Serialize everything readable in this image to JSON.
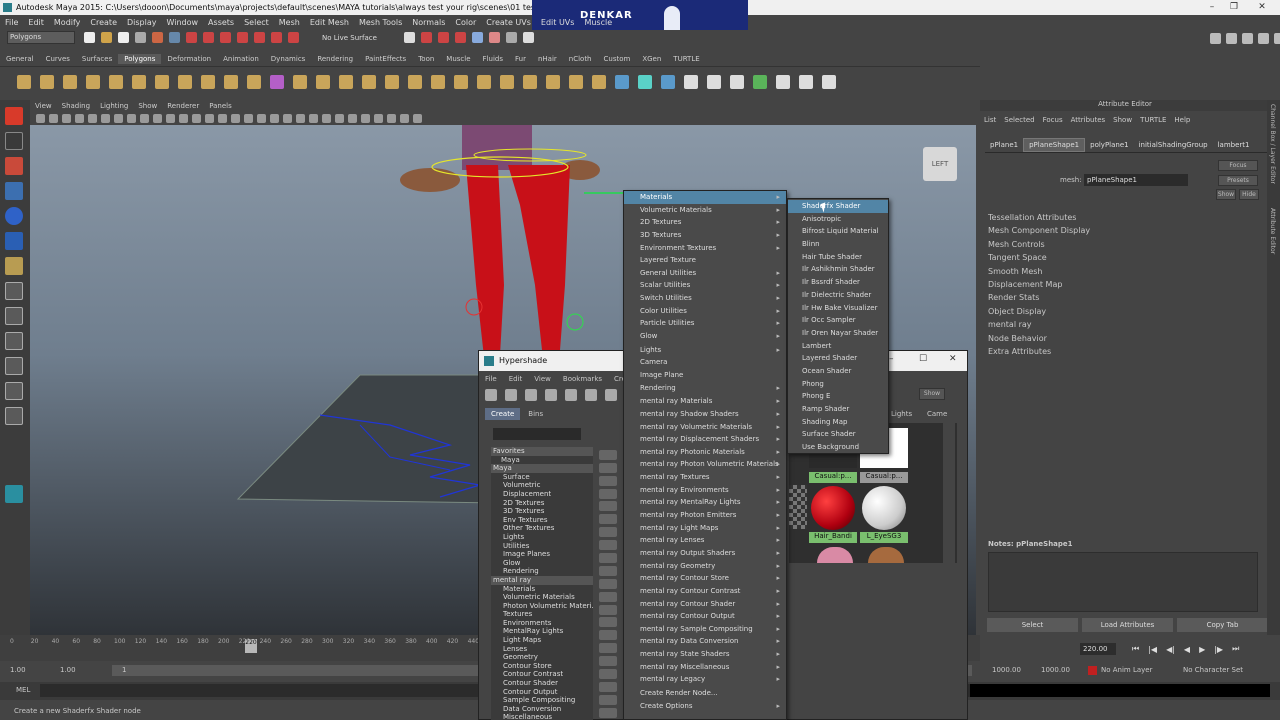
{
  "window": {
    "title": "Autodesk Maya 2015: C:\\Users\\dooon\\Documents\\maya\\projects\\default\\scenes\\MAYA tutorials\\always test your rig\\scenes\\01 test rig.mb*  ---"
  },
  "logo": {
    "text": "DENKAR"
  },
  "menubar": [
    "File",
    "Edit",
    "Modify",
    "Create",
    "Display",
    "Window",
    "Assets",
    "Select",
    "Mesh",
    "Edit Mesh",
    "Mesh Tools",
    "Normals",
    "Color",
    "Create UVs",
    "Edit UVs",
    "Muscle"
  ],
  "statusline": {
    "menuset": "Polygons",
    "live_surface": "No Live Surface"
  },
  "shelf": {
    "tabs": [
      "General",
      "Curves",
      "Surfaces",
      "Polygons",
      "Deformation",
      "Animation",
      "Dynamics",
      "Rendering",
      "PaintEffects",
      "Toon",
      "Muscle",
      "Fluids",
      "Fur",
      "nHair",
      "nCloth",
      "Custom",
      "XGen",
      "TURTLE"
    ],
    "active": "Polygons"
  },
  "viewport": {
    "menu": [
      "View",
      "Shading",
      "Lighting",
      "Show",
      "Renderer",
      "Panels"
    ],
    "view_cube": "LEFT"
  },
  "attribute_editor": {
    "header": "Attribute Editor",
    "menu": [
      "List",
      "Selected",
      "Focus",
      "Attributes",
      "Show",
      "TURTLE",
      "Help"
    ],
    "tabs": [
      "pPlane1",
      "pPlaneShape1",
      "polyPlane1",
      "initialShadingGroup",
      "lambert1"
    ],
    "active_tab": "pPlaneShape1",
    "buttons": {
      "focus": "Focus",
      "presets": "Presets",
      "show": "Show",
      "hide": "Hide"
    },
    "mesh_label": "mesh:",
    "mesh_value": "pPlaneShape1",
    "sections": [
      "Tessellation Attributes",
      "Mesh Component Display",
      "Mesh Controls",
      "Tangent Space",
      "Smooth Mesh",
      "Displacement Map",
      "Render Stats",
      "Object Display",
      "mental ray",
      "Node Behavior",
      "Extra Attributes"
    ],
    "notes_label": "Notes: pPlaneShape1",
    "bottom": [
      "Select",
      "Load Attributes",
      "Copy Tab"
    ],
    "side_tabs": [
      "Channel Box / Layer Editor",
      "Attribute Editor"
    ]
  },
  "timeline": {
    "ticks": [
      "0",
      "20",
      "40",
      "60",
      "80",
      "100",
      "120",
      "140",
      "160",
      "180",
      "200",
      "220",
      "240",
      "260",
      "280",
      "300",
      "320",
      "340",
      "360",
      "380",
      "400",
      "420",
      "440"
    ],
    "current_frame": "220",
    "end_frame": "220.00"
  },
  "range": {
    "start": "1.00",
    "start2": "1.00",
    "frame": "1",
    "end1": "1000.00",
    "end2": "1000.00",
    "anim_layer": "No Anim Layer",
    "char_set": "No Character Set"
  },
  "command_line": {
    "label": "MEL"
  },
  "help_line": "Create a new Shaderfx Shader node",
  "hypershade": {
    "title": "Hypershade",
    "menu": [
      "File",
      "Edit",
      "View",
      "Bookmarks",
      "Create"
    ],
    "tabs": [
      "Create",
      "Bins"
    ],
    "show_btn": "Show",
    "right_tabs": [
      "Lights",
      "Cameras"
    ],
    "tree": [
      "Favorites",
      "Maya",
      "Maya",
      "Surface",
      "Volumetric",
      "Displacement",
      "2D Textures",
      "3D Textures",
      "Env Textures",
      "Other Textures",
      "Lights",
      "Utilities",
      "Image Planes",
      "Glow",
      "Rendering",
      "mental ray",
      "Materials",
      "Volumetric Materials",
      "Photon Volumetric Materi...",
      "Textures",
      "Environments",
      "MentalRay Lights",
      "Light Maps",
      "Lenses",
      "Geometry",
      "Contour Store",
      "Contour Contrast",
      "Contour Shader",
      "Contour Output",
      "Sample Compositing",
      "Data Conversion",
      "Miscellaneous"
    ],
    "swatch_labels": [
      "Casual:p...",
      "Casual:p...",
      "Hair_Bandi",
      "L_EyeSG3"
    ],
    "colors": {
      "red": "#c0001a",
      "white": "#e8e8e8",
      "pink": "#d98aa5",
      "brown": "#a66a3e",
      "dark": "#2a2a2a"
    }
  },
  "create_menu": [
    {
      "label": "Materials",
      "sub": true,
      "hl": true
    },
    {
      "label": "Volumetric Materials",
      "sub": true
    },
    {
      "label": "2D Textures",
      "sub": true
    },
    {
      "label": "3D Textures",
      "sub": true
    },
    {
      "label": "Environment Textures",
      "sub": true
    },
    {
      "label": "Layered Texture",
      "sub": false
    },
    {
      "label": "General Utilities",
      "sub": true
    },
    {
      "label": "Scalar Utilities",
      "sub": true
    },
    {
      "label": "Switch Utilities",
      "sub": true
    },
    {
      "label": "Color Utilities",
      "sub": true
    },
    {
      "label": "Particle Utilities",
      "sub": true
    },
    {
      "label": "Glow",
      "sub": true
    },
    {
      "label": "Lights",
      "sub": true
    },
    {
      "label": "Camera",
      "sub": false
    },
    {
      "label": "Image Plane",
      "sub": false
    },
    {
      "label": "Rendering",
      "sub": true
    },
    {
      "label": "mental ray Materials",
      "sub": true
    },
    {
      "label": "mental ray Shadow Shaders",
      "sub": true
    },
    {
      "label": "mental ray Volumetric Materials",
      "sub": true
    },
    {
      "label": "mental ray Displacement Shaders",
      "sub": true
    },
    {
      "label": "mental ray Photonic Materials",
      "sub": true
    },
    {
      "label": "mental ray Photon Volumetric Materials",
      "sub": true
    },
    {
      "label": "mental ray Textures",
      "sub": true
    },
    {
      "label": "mental ray Environments",
      "sub": true
    },
    {
      "label": "mental ray MentalRay Lights",
      "sub": true
    },
    {
      "label": "mental ray Photon Emitters",
      "sub": true
    },
    {
      "label": "mental ray Light Maps",
      "sub": true
    },
    {
      "label": "mental ray Lenses",
      "sub": true
    },
    {
      "label": "mental ray Output Shaders",
      "sub": true
    },
    {
      "label": "mental ray Geometry",
      "sub": true
    },
    {
      "label": "mental ray Contour Store",
      "sub": true
    },
    {
      "label": "mental ray Contour Contrast",
      "sub": true
    },
    {
      "label": "mental ray Contour Shader",
      "sub": true
    },
    {
      "label": "mental ray Contour Output",
      "sub": true
    },
    {
      "label": "mental ray Sample Compositing",
      "sub": true
    },
    {
      "label": "mental ray Data Conversion",
      "sub": true
    },
    {
      "label": "mental ray State Shaders",
      "sub": true
    },
    {
      "label": "mental ray Miscellaneous",
      "sub": true
    },
    {
      "label": "mental ray Legacy",
      "sub": true
    },
    {
      "label": "Create Render Node...",
      "sub": false
    },
    {
      "label": "Create Options",
      "sub": true
    }
  ],
  "materials_submenu": [
    "Shaderfx Shader",
    "Anisotropic",
    "Bifrost Liquid Material",
    "Blinn",
    "Hair Tube Shader",
    "Ilr Ashikhmin Shader",
    "Ilr Bssrdf Shader",
    "Ilr Dielectric Shader",
    "Ilr Hw Bake Visualizer",
    "Ilr Occ Sampler",
    "Ilr Oren Nayar Shader",
    "Lambert",
    "Layered Shader",
    "Ocean Shader",
    "Phong",
    "Phong E",
    "Ramp Shader",
    "Shading Map",
    "Surface Shader",
    "Use Background"
  ],
  "materials_submenu_hl": 0
}
